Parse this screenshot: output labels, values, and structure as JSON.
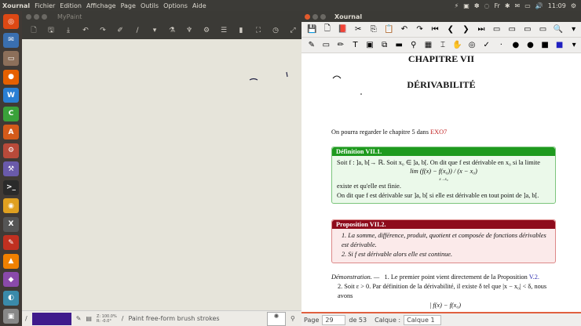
{
  "topbar": {
    "menus": [
      "Xournal",
      "Fichier",
      "Edition",
      "Affichage",
      "Page",
      "Outils",
      "Options",
      "Aide"
    ],
    "clock": "11:09"
  },
  "launcher": {
    "icons": [
      {
        "name": "ubuntu",
        "color": "#dd4814",
        "g": "◎"
      },
      {
        "name": "thunderbird",
        "color": "#3a6fb0",
        "g": "✉"
      },
      {
        "name": "files",
        "color": "#8c6f5a",
        "g": "▭"
      },
      {
        "name": "firefox",
        "color": "#e66000",
        "g": "●"
      },
      {
        "name": "writer",
        "color": "#2a7fd4",
        "g": "W"
      },
      {
        "name": "calc",
        "color": "#3aa13a",
        "g": "C"
      },
      {
        "name": "impress",
        "color": "#d45a1a",
        "g": "A"
      },
      {
        "name": "settings",
        "color": "#b84a3a",
        "g": "⚙"
      },
      {
        "name": "software",
        "color": "#6a5aaa",
        "g": "⚒"
      },
      {
        "name": "terminal",
        "color": "#2a2a2a",
        "g": ">_"
      },
      {
        "name": "app",
        "color": "#e0a020",
        "g": "◉"
      },
      {
        "name": "xournal",
        "color": "#555",
        "g": "X"
      },
      {
        "name": "tool",
        "color": "#c03020",
        "g": "✎"
      },
      {
        "name": "vlc",
        "color": "#f08000",
        "g": "▲"
      },
      {
        "name": "app2",
        "color": "#8a4aaa",
        "g": "◆"
      },
      {
        "name": "app3",
        "color": "#3a8aaa",
        "g": "◐"
      },
      {
        "name": "app4",
        "color": "#888",
        "g": "▣"
      }
    ]
  },
  "mypaint": {
    "title": "MyPaint",
    "tools": [
      "🗋",
      "🖫",
      "⤓",
      "↶",
      "↷",
      "✐",
      "/",
      "▾",
      "⚗",
      "♆",
      "⚙",
      "☰",
      "▮",
      "⛶",
      "◷",
      "⤢"
    ],
    "status": {
      "zoom": "Z: 100.0%",
      "rotation": "R: -0.0°",
      "hint": "Paint free-form brush strokes"
    },
    "color": "#3f1a8c"
  },
  "xournal": {
    "title": "Xournal",
    "toolbar1": [
      "💾",
      "🗋",
      "📕",
      "✂",
      "⎘",
      "📋",
      "↶",
      "↷",
      "⏮",
      "❮",
      "❯",
      "⏭",
      "▭",
      "▭",
      "▭",
      "▭",
      "🔍",
      "▾"
    ],
    "toolbar2": [
      "✎",
      "▭",
      "✏",
      "T",
      "▣",
      "⧉",
      "▬",
      "⚲",
      "▦",
      "⌶",
      "✋",
      "◎",
      "✓",
      "·",
      "●",
      "●",
      "■",
      "■",
      "▾"
    ],
    "document": {
      "chapter": "CHAPITRE VII",
      "title": "DÉRIVABILITÉ",
      "intro": "On pourra regarder le chapitre 5 dans ",
      "intro_link": "EXO7",
      "definition": {
        "header": "Définition VII.1.",
        "line1": "Soit f : ]a, b[→ ℝ. Soit x₀ ∈ ]a, b[. On dit que f est dérivable en x₀ si la limite",
        "formula": "lim (f(x) − f(x₀)) / (x − x₀)",
        "formula_sub": "x→x₀",
        "line2": "existe et qu'elle est finie.",
        "line3": "On dit que f est dérivable sur ]a, b[ si elle est dérivable en tout point de ]a, b[."
      },
      "proposition": {
        "header": "Proposition VII.2.",
        "items": [
          "1.  La somme, différence, produit, quotient et composée de fonctions dérivables est dérivable.",
          "2.  Si f est dérivable alors elle est continue."
        ]
      },
      "demo": {
        "label": "Démonstration. —",
        "item1": "1. Le premier point vient directement de la Proposition ",
        "item1_link": "V.2.",
        "item2": "2. Soit ε > 0. Par définition de la dérivabilité, il existe δ tel que |x − x₀| < δ, nous avons",
        "formula": "| f(x) − f(x₀)"
      }
    },
    "status": {
      "page_label": "Page",
      "page": "29",
      "of": "de 53",
      "layer_label": "Calque :",
      "layer": "Calque 1"
    }
  }
}
